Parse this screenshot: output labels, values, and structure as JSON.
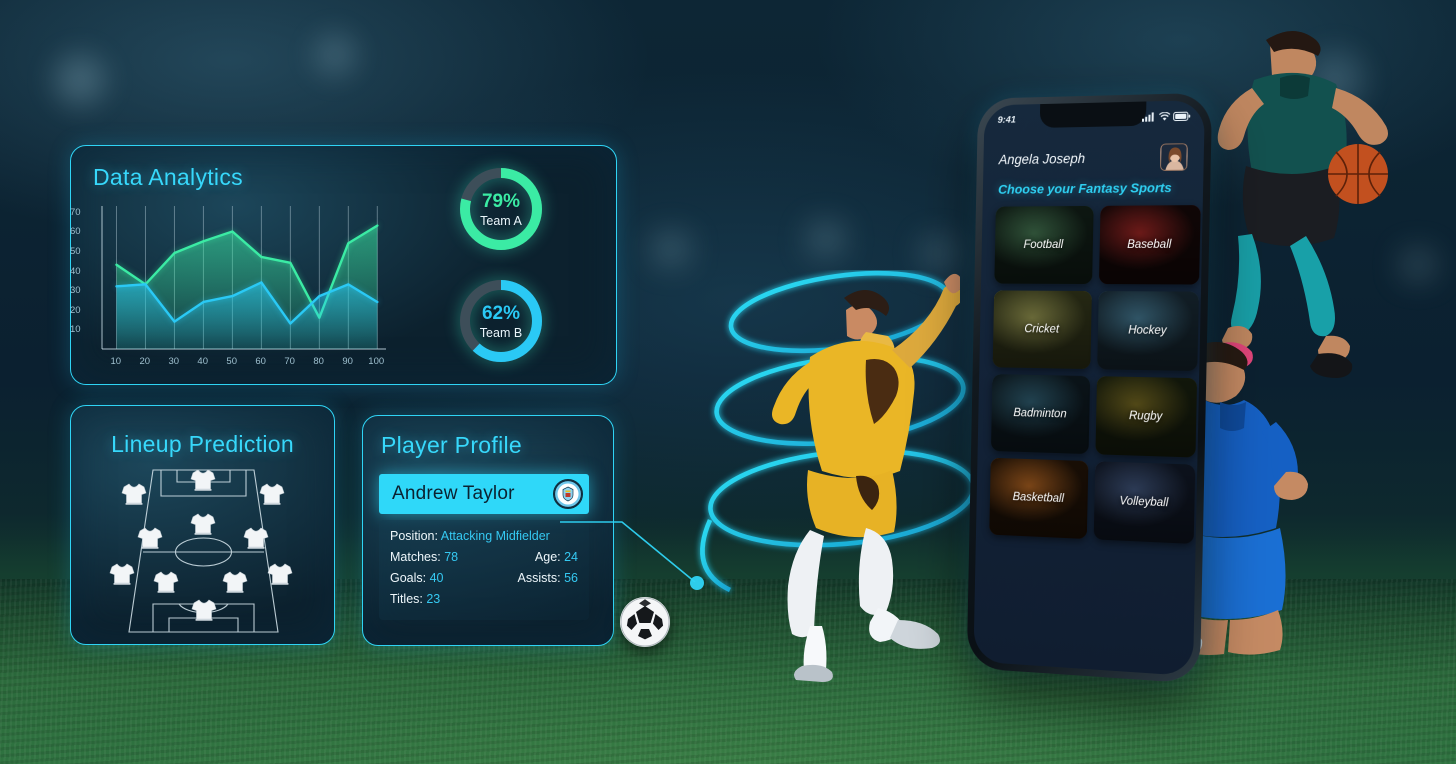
{
  "analytics": {
    "title": "Data Analytics",
    "gauges": [
      {
        "value": "79%",
        "team": "Team A",
        "pct": 79,
        "color": "#3BEBA4"
      },
      {
        "value": "62%",
        "team": "Team B",
        "pct": 62,
        "color": "#2AC9F5"
      }
    ]
  },
  "chart_data": {
    "type": "area",
    "title": "Data Analytics",
    "xlabel": "",
    "ylabel": "",
    "x": [
      10,
      20,
      30,
      40,
      50,
      60,
      70,
      80,
      90,
      100
    ],
    "xticklabels": [
      "10",
      "20",
      "30",
      "40",
      "50",
      "60",
      "70",
      "80",
      "90",
      "100"
    ],
    "yticklabels": [
      "10",
      "20",
      "30",
      "40",
      "50",
      "60",
      "70"
    ],
    "xlim": [
      5,
      103
    ],
    "ylim": [
      0,
      73
    ],
    "grid": true,
    "legend": "none",
    "series": [
      {
        "name": "Team A",
        "color": "#3BEBA4",
        "values": [
          43,
          33,
          49,
          55,
          60,
          47,
          44,
          16,
          54,
          63
        ]
      },
      {
        "name": "Team B",
        "color": "#2AC9F5",
        "values": [
          32,
          33,
          14,
          24,
          27,
          34,
          13,
          27,
          33,
          24
        ]
      }
    ]
  },
  "lineup": {
    "title": "Lineup Prediction",
    "formation": "4-3-3",
    "players": 11
  },
  "profile": {
    "title": "Player Profile",
    "name": "Andrew Taylor",
    "badge": "club-crest",
    "stats": [
      [
        {
          "label": "Position:",
          "value": "Attacking Midfielder"
        }
      ],
      [
        {
          "label": "Matches:",
          "value": "78"
        },
        {
          "label": "Age:",
          "value": "24"
        }
      ],
      [
        {
          "label": "Goals:",
          "value": "40"
        },
        {
          "label": "Assists:",
          "value": "56"
        }
      ],
      [
        {
          "label": "Titles:",
          "value": "23"
        }
      ]
    ]
  },
  "phone": {
    "status": {
      "time": "9:41",
      "signal": "signal-icon",
      "wifi": "wifi-icon",
      "battery": "battery-icon"
    },
    "user": {
      "name": "Angela Joseph",
      "avatar": "user-avatar"
    },
    "section_title": "Choose your Fantasy Sports",
    "tiles": [
      {
        "label": "Football",
        "c1": "#3e6b4a",
        "c2": "#0f1a14"
      },
      {
        "label": "Baseball",
        "c1": "#8e2220",
        "c2": "#120707"
      },
      {
        "label": "Cricket",
        "c1": "#8a8a4a",
        "c2": "#2a2d16"
      },
      {
        "label": "Hockey",
        "c1": "#3f6f86",
        "c2": "#14222b"
      },
      {
        "label": "Badminton",
        "c1": "#2b5668",
        "c2": "#0c161c"
      },
      {
        "label": "Rugby",
        "c1": "#6b5f1e",
        "c2": "#141a0c"
      },
      {
        "label": "Basketball",
        "c1": "#a05a1e",
        "c2": "#1c1006"
      },
      {
        "label": "Volleyball",
        "c1": "#3a4d70",
        "c2": "#0e1420"
      }
    ]
  },
  "colors": {
    "accent_cyan": "#2FD4F5",
    "accent_green": "#3BEBA4",
    "panel_bg": "#0C2333",
    "grass": "#2C6B3C"
  }
}
